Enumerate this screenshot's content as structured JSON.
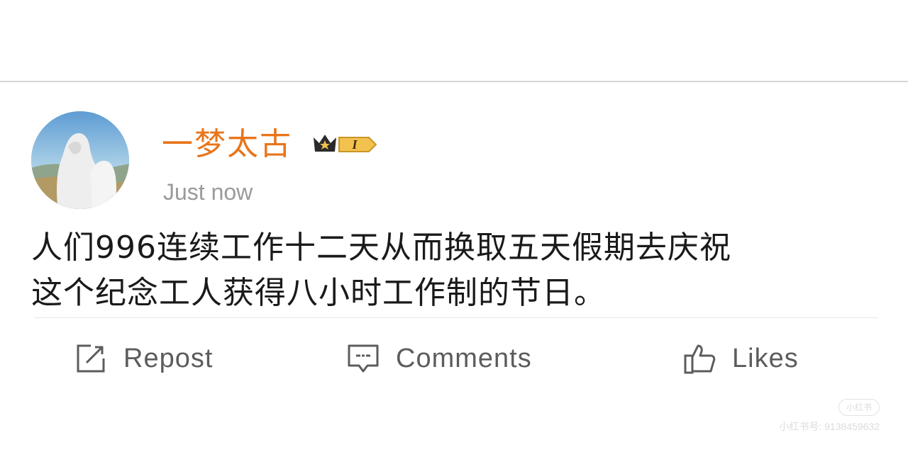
{
  "post": {
    "username": "一梦太古",
    "vip_level": "I",
    "timestamp": "Just now",
    "text_lines": [
      "人们996连续工作十二天从而换取五天假期去庆祝",
      "这个纪念工人获得八小时工作制的节日。"
    ]
  },
  "actions": {
    "repost": {
      "label": "Repost",
      "icon": "edit-square-icon"
    },
    "comments": {
      "label": "Comments",
      "icon": "comment-bubble-icon"
    },
    "likes": {
      "label": "Likes",
      "icon": "thumbs-up-icon"
    }
  },
  "watermark": {
    "logo": "小红书",
    "id_text": "小红书号: 9138459632"
  },
  "colors": {
    "username": "#e8751a",
    "timestamp": "#9a9a9a",
    "action_text": "#5c5c5c",
    "badge_gold": "#f2c14e"
  }
}
